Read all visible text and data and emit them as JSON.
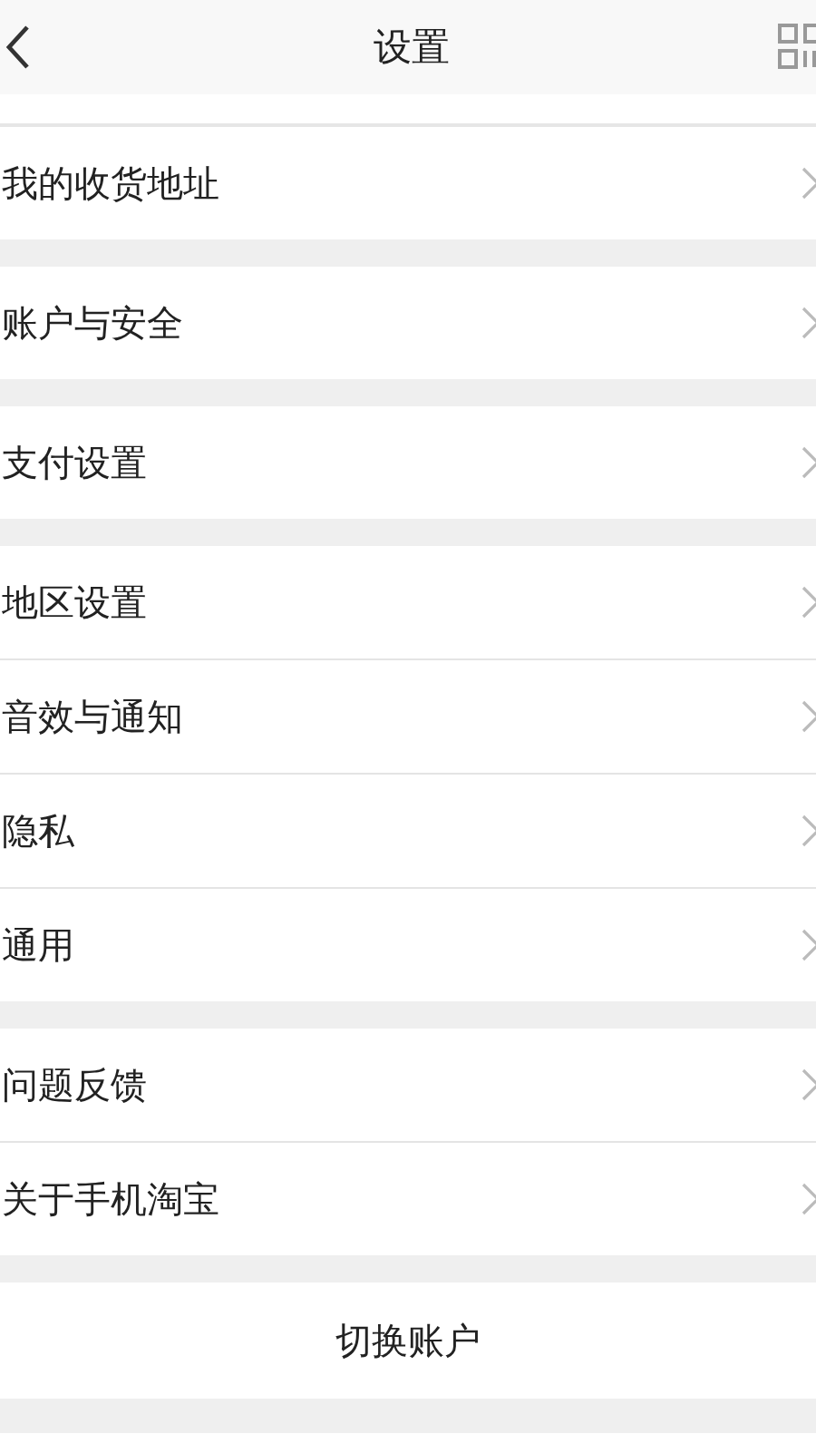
{
  "header": {
    "title": "设置"
  },
  "groups": [
    {
      "items": [
        {
          "label": "我的收货地址"
        }
      ]
    },
    {
      "items": [
        {
          "label": "账户与安全"
        }
      ]
    },
    {
      "items": [
        {
          "label": "支付设置"
        }
      ]
    },
    {
      "items": [
        {
          "label": "地区设置"
        },
        {
          "label": "音效与通知"
        },
        {
          "label": "隐私"
        },
        {
          "label": "通用"
        }
      ]
    },
    {
      "items": [
        {
          "label": "问题反馈"
        },
        {
          "label": "关于手机淘宝"
        }
      ]
    }
  ],
  "switch_account": "切换账户"
}
